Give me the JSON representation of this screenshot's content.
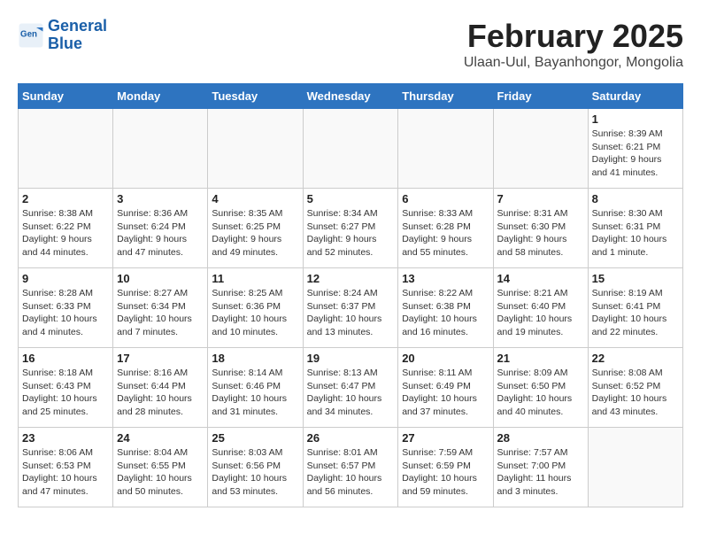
{
  "logo": {
    "line1": "General",
    "line2": "Blue"
  },
  "title": "February 2025",
  "subtitle": "Ulaan-Uul, Bayanhongor, Mongolia",
  "weekdays": [
    "Sunday",
    "Monday",
    "Tuesday",
    "Wednesday",
    "Thursday",
    "Friday",
    "Saturday"
  ],
  "weeks": [
    [
      {
        "day": "",
        "info": ""
      },
      {
        "day": "",
        "info": ""
      },
      {
        "day": "",
        "info": ""
      },
      {
        "day": "",
        "info": ""
      },
      {
        "day": "",
        "info": ""
      },
      {
        "day": "",
        "info": ""
      },
      {
        "day": "1",
        "info": "Sunrise: 8:39 AM\nSunset: 6:21 PM\nDaylight: 9 hours and 41 minutes."
      }
    ],
    [
      {
        "day": "2",
        "info": "Sunrise: 8:38 AM\nSunset: 6:22 PM\nDaylight: 9 hours and 44 minutes."
      },
      {
        "day": "3",
        "info": "Sunrise: 8:36 AM\nSunset: 6:24 PM\nDaylight: 9 hours and 47 minutes."
      },
      {
        "day": "4",
        "info": "Sunrise: 8:35 AM\nSunset: 6:25 PM\nDaylight: 9 hours and 49 minutes."
      },
      {
        "day": "5",
        "info": "Sunrise: 8:34 AM\nSunset: 6:27 PM\nDaylight: 9 hours and 52 minutes."
      },
      {
        "day": "6",
        "info": "Sunrise: 8:33 AM\nSunset: 6:28 PM\nDaylight: 9 hours and 55 minutes."
      },
      {
        "day": "7",
        "info": "Sunrise: 8:31 AM\nSunset: 6:30 PM\nDaylight: 9 hours and 58 minutes."
      },
      {
        "day": "8",
        "info": "Sunrise: 8:30 AM\nSunset: 6:31 PM\nDaylight: 10 hours and 1 minute."
      }
    ],
    [
      {
        "day": "9",
        "info": "Sunrise: 8:28 AM\nSunset: 6:33 PM\nDaylight: 10 hours and 4 minutes."
      },
      {
        "day": "10",
        "info": "Sunrise: 8:27 AM\nSunset: 6:34 PM\nDaylight: 10 hours and 7 minutes."
      },
      {
        "day": "11",
        "info": "Sunrise: 8:25 AM\nSunset: 6:36 PM\nDaylight: 10 hours and 10 minutes."
      },
      {
        "day": "12",
        "info": "Sunrise: 8:24 AM\nSunset: 6:37 PM\nDaylight: 10 hours and 13 minutes."
      },
      {
        "day": "13",
        "info": "Sunrise: 8:22 AM\nSunset: 6:38 PM\nDaylight: 10 hours and 16 minutes."
      },
      {
        "day": "14",
        "info": "Sunrise: 8:21 AM\nSunset: 6:40 PM\nDaylight: 10 hours and 19 minutes."
      },
      {
        "day": "15",
        "info": "Sunrise: 8:19 AM\nSunset: 6:41 PM\nDaylight: 10 hours and 22 minutes."
      }
    ],
    [
      {
        "day": "16",
        "info": "Sunrise: 8:18 AM\nSunset: 6:43 PM\nDaylight: 10 hours and 25 minutes."
      },
      {
        "day": "17",
        "info": "Sunrise: 8:16 AM\nSunset: 6:44 PM\nDaylight: 10 hours and 28 minutes."
      },
      {
        "day": "18",
        "info": "Sunrise: 8:14 AM\nSunset: 6:46 PM\nDaylight: 10 hours and 31 minutes."
      },
      {
        "day": "19",
        "info": "Sunrise: 8:13 AM\nSunset: 6:47 PM\nDaylight: 10 hours and 34 minutes."
      },
      {
        "day": "20",
        "info": "Sunrise: 8:11 AM\nSunset: 6:49 PM\nDaylight: 10 hours and 37 minutes."
      },
      {
        "day": "21",
        "info": "Sunrise: 8:09 AM\nSunset: 6:50 PM\nDaylight: 10 hours and 40 minutes."
      },
      {
        "day": "22",
        "info": "Sunrise: 8:08 AM\nSunset: 6:52 PM\nDaylight: 10 hours and 43 minutes."
      }
    ],
    [
      {
        "day": "23",
        "info": "Sunrise: 8:06 AM\nSunset: 6:53 PM\nDaylight: 10 hours and 47 minutes."
      },
      {
        "day": "24",
        "info": "Sunrise: 8:04 AM\nSunset: 6:55 PM\nDaylight: 10 hours and 50 minutes."
      },
      {
        "day": "25",
        "info": "Sunrise: 8:03 AM\nSunset: 6:56 PM\nDaylight: 10 hours and 53 minutes."
      },
      {
        "day": "26",
        "info": "Sunrise: 8:01 AM\nSunset: 6:57 PM\nDaylight: 10 hours and 56 minutes."
      },
      {
        "day": "27",
        "info": "Sunrise: 7:59 AM\nSunset: 6:59 PM\nDaylight: 10 hours and 59 minutes."
      },
      {
        "day": "28",
        "info": "Sunrise: 7:57 AM\nSunset: 7:00 PM\nDaylight: 11 hours and 3 minutes."
      },
      {
        "day": "",
        "info": ""
      }
    ]
  ]
}
